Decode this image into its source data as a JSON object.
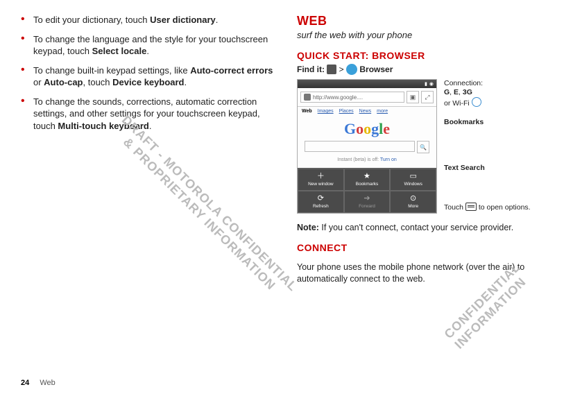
{
  "left": {
    "bullets": [
      {
        "pre": "To edit your dictionary, touch ",
        "b1": "User dictionary",
        "post": "."
      },
      {
        "pre": "To change the language and the style for your touchscreen keypad, touch ",
        "b1": "Select locale",
        "post": "."
      },
      {
        "pre": "To change built-in keypad settings, like ",
        "b1": "Auto-correct errors",
        "mid": " or ",
        "b2": "Auto-cap",
        "mid2": ", touch ",
        "b3": "Device keyboard",
        "post": "."
      },
      {
        "pre": "To change the sounds, corrections, automatic correction settings, and other settings for your touchscreen keypad, touch ",
        "b1": "Multi-touch keyboard",
        "post": "."
      }
    ]
  },
  "right": {
    "title": "WEB",
    "subtitle": "surf the web with your phone",
    "qs_title": "QUICK START: BROWSER",
    "findit_pre": "Find it:",
    "findit_gt": ">",
    "findit_browser": "Browser",
    "phone": {
      "url": "http://www.google....",
      "tabs": [
        "Web",
        "Images",
        "Places",
        "News",
        "more"
      ],
      "instant_off": "Instant (beta) is off:",
      "instant_on": "Turn on",
      "menu": [
        "New window",
        "Bookmarks",
        "Windows",
        "Refresh",
        "Forward",
        "More"
      ]
    },
    "callouts": {
      "connection": "Connection:",
      "conn_codes_g": "G",
      "conn_codes_e": "E",
      "conn_codes_3g": "3G",
      "conn_or": "or Wi-Fi",
      "bookmarks": "Bookmarks",
      "textsearch": "Text Search",
      "touch_pre": "Touch ",
      "touch_post": " to open options."
    },
    "note_label": "Note:",
    "note_text": " If you can't connect, contact your service provider.",
    "connect_title": "CONNECT",
    "connect_body": "Your phone uses the mobile phone network (over the air) to automatically connect to the web."
  },
  "watermark1": "DRAFT - MOTOROLA CONFIDENTIAL\n    & PROPRIETARY INFORMATION",
  "watermark2": "CONFIDENTIAL\nINFORMATION",
  "footer": {
    "page": "24",
    "section": "Web"
  }
}
